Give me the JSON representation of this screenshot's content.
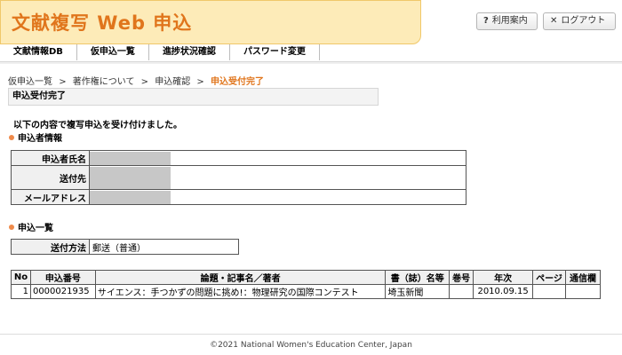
{
  "header": {
    "logo_text": "文献複写 Web 申込",
    "help_icon": "question-icon",
    "help_label": "利用案内",
    "logout_icon": "close-icon",
    "logout_label": "ログアウト"
  },
  "nav": {
    "items": [
      "文献情報DB",
      "仮申込一覧",
      "進捗状況確認",
      "パスワード変更"
    ]
  },
  "breadcrumb": {
    "items": [
      "仮申込一覧",
      "著作権について",
      "申込確認"
    ],
    "separator": ">",
    "current": "申込受付完了"
  },
  "page_title": "申込受付完了",
  "message": "以下の内容で複写申込を受け付けました。",
  "applicant": {
    "heading": "申込者情報",
    "rows": [
      {
        "label": "申込者氏名"
      },
      {
        "label": "送付先"
      },
      {
        "label": "メールアドレス"
      }
    ]
  },
  "request_list": {
    "heading": "申込一覧",
    "method_label": "送付方法",
    "method_value": "郵送（普通）"
  },
  "orders": {
    "columns": [
      "No",
      "申込番号",
      "論題・記事名／著者",
      "書（誌）名等",
      "巻号",
      "年次",
      "ページ",
      "通信欄"
    ],
    "rows": [
      [
        "1",
        "0000021935",
        "サイエンス：手つかずの問題に挑め!：物理研究の国際コンテスト",
        "埼玉新聞",
        "",
        "2010.09.15",
        "",
        ""
      ]
    ]
  },
  "footer": "©2021 National Women's Education Center, Japan",
  "colors": {
    "logo_bg": "#fdebb8",
    "accent": "#e0751c",
    "bullet": "#ef8a4a",
    "header_cell": "#f0f0f0",
    "masked": "#c7c7c7"
  }
}
